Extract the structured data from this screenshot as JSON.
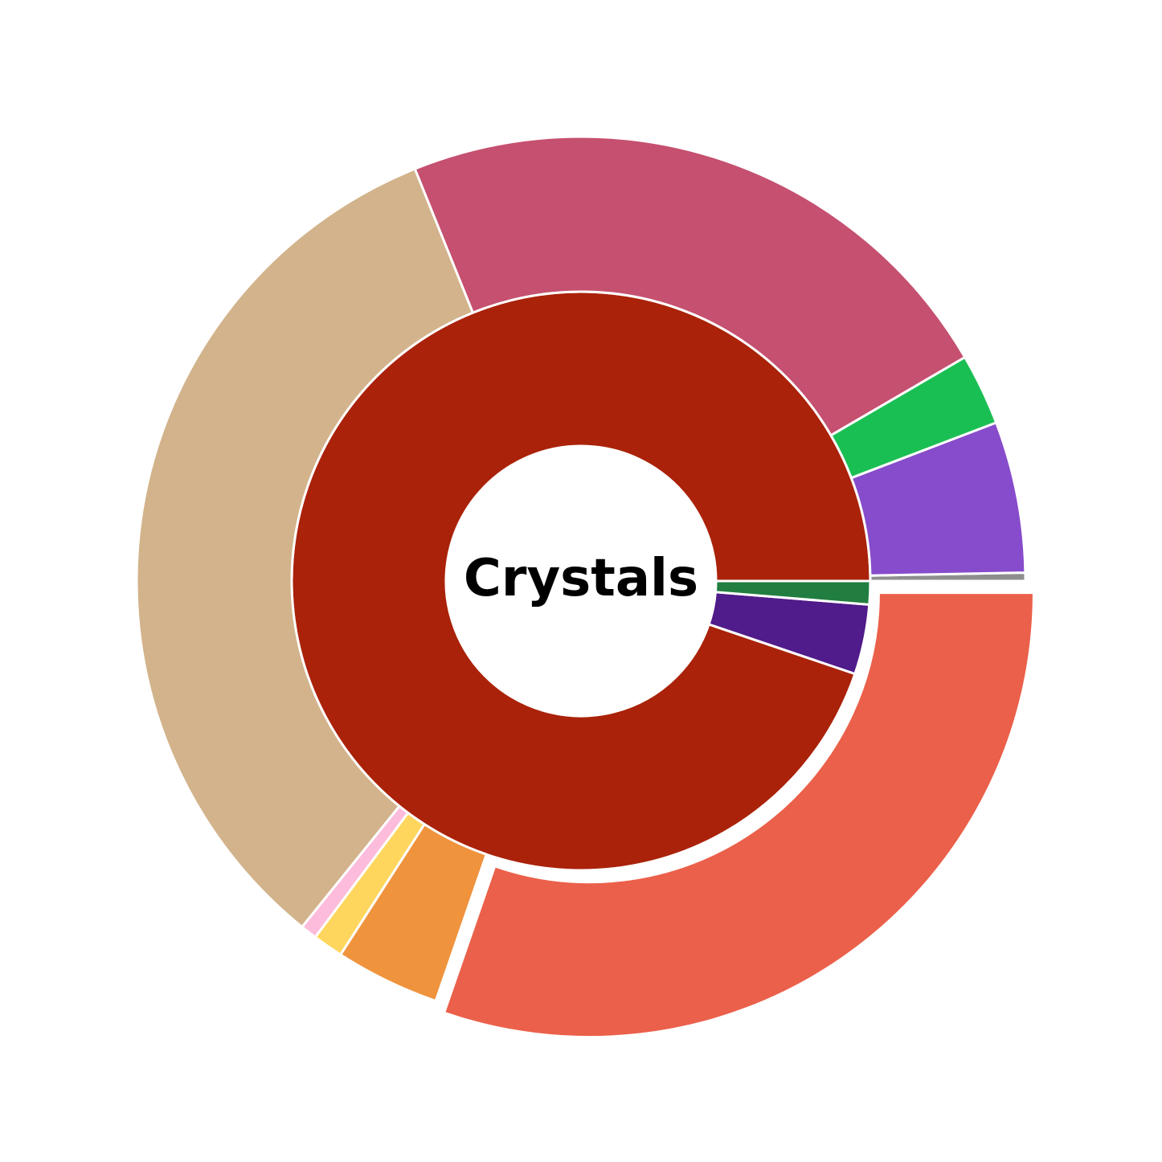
{
  "chart_data": {
    "type": "sunburst",
    "center_label": "Crystals",
    "inner_ring": [
      {
        "value": 94.8,
        "color": "#aa220a"
      },
      {
        "value": 3.9,
        "color": "#501b8a"
      },
      {
        "value": 1.3,
        "color": "#217e40"
      }
    ],
    "outer_ring": [
      {
        "value": 0.3,
        "color": "#8e8e8e",
        "parent": 1
      },
      {
        "value": 5.5,
        "color": "#874ccb",
        "parent": 1
      },
      {
        "value": 2.6,
        "color": "#1abf54",
        "parent": 2
      },
      {
        "value": 22.7,
        "color": "#c5506f",
        "parent": 0
      },
      {
        "value": 33.1,
        "color": "#d2b38b",
        "parent": 0
      },
      {
        "value": 0.6,
        "color": "#fdbcdb",
        "parent": 0
      },
      {
        "value": 1.1,
        "color": "#ffd65d",
        "parent": 0
      },
      {
        "value": 3.8,
        "color": "#ef933d",
        "parent": 0
      },
      {
        "value": 30.3,
        "color": "#eb604a",
        "parent": 0,
        "exploded": true
      }
    ]
  }
}
